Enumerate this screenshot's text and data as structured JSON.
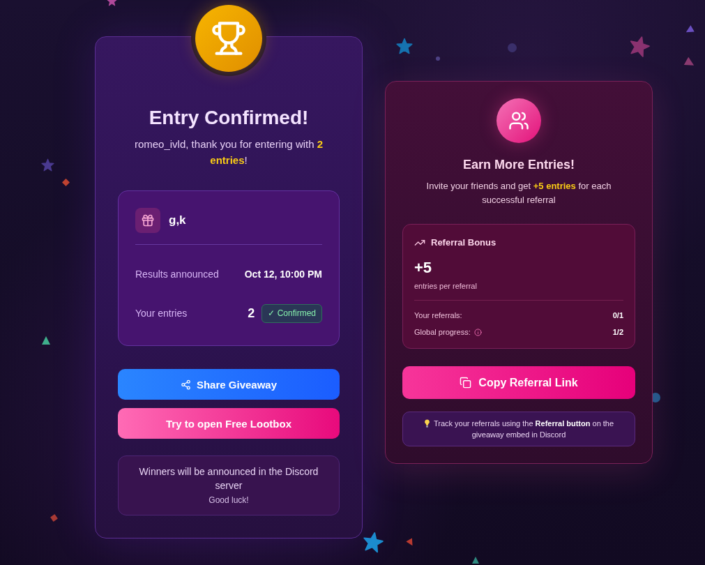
{
  "entry": {
    "title": "Entry Confirmed!",
    "message": "romeo_ivld, thank you for entering with **2 entries**!",
    "prize": {
      "name": "g,k"
    },
    "details": [
      {
        "label": "Results announced",
        "value": "Oct 12, 10:00 PM"
      },
      {
        "label": "Your entries",
        "value": "2",
        "badge": "✓ Confirmed"
      }
    ],
    "buttons": [
      {
        "kind": "share",
        "label": "Share Giveaway"
      },
      {
        "kind": "lootbox",
        "label": "Try to open Free Lootbox"
      }
    ],
    "note": {
      "text": "Winners will be announced in the Discord server",
      "subtext": "Good luck!"
    }
  },
  "referral": {
    "title": "Earn More Entries!",
    "description": "Invite your friends and get **+5 entries** for each successful referral",
    "bonus": {
      "title": "Referral Bonus",
      "amount": "+5",
      "caption": "entries per referral",
      "stats": [
        {
          "label": "Your referrals:",
          "value": "0/1",
          "info": false
        },
        {
          "label": "Global progress:",
          "value": "1/2",
          "info": true
        }
      ]
    },
    "button": {
      "label": "Copy Referral Link"
    },
    "tip": "Track your referrals using the **Referral button** on the giveaway embed in Discord"
  }
}
